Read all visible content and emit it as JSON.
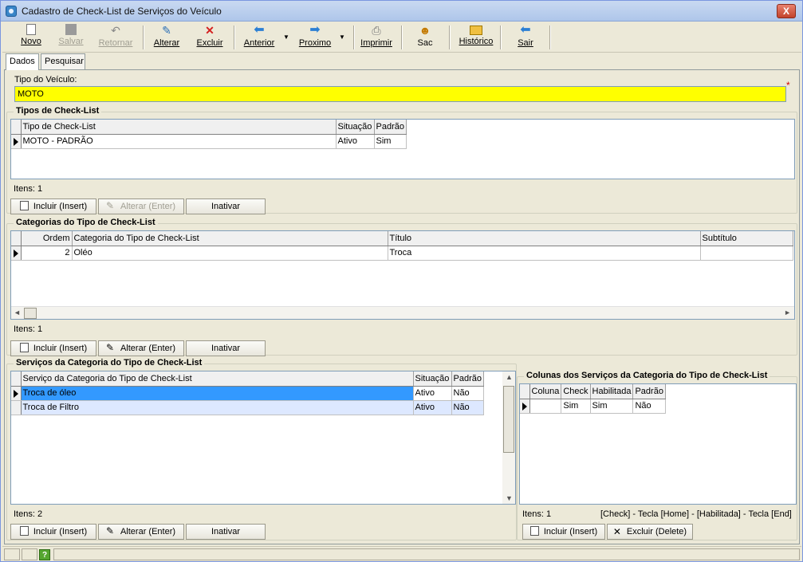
{
  "window": {
    "title": "Cadastro de Check-List de Serviços do Veículo",
    "close": "X"
  },
  "toolbar": {
    "novo": "Novo",
    "salvar": "Salvar",
    "retornar": "Retornar",
    "alterar": "Alterar",
    "excluir": "Excluir",
    "anterior": "Anterior",
    "proximo": "Proximo",
    "imprimir": "Imprimir",
    "sac": "Sac",
    "historico": "Histórico",
    "sair": "Sair"
  },
  "tabs": {
    "dados": "Dados",
    "pesquisar": "Pesquisar"
  },
  "tipo_veiculo": {
    "label": "Tipo do Veículo:",
    "value": "MOTO",
    "required": "*"
  },
  "tipos": {
    "title": "Tipos de Check-List",
    "headers": [
      "Tipo de Check-List",
      "Situação",
      "Padrão"
    ],
    "rows": [
      [
        "MOTO - PADRÃO",
        "Ativo",
        "Sim"
      ]
    ],
    "items_label": "Itens:",
    "items_count": "1",
    "incluir": "Incluir (Insert)",
    "alterar": "Alterar (Enter)",
    "inativar": "Inativar"
  },
  "categorias": {
    "title": "Categorias do Tipo de Check-List",
    "headers": [
      "Ordem",
      "Categoria do Tipo de Check-List",
      "Título",
      "Subtítulo"
    ],
    "rows": [
      [
        "2",
        "Oléo",
        "Troca",
        ""
      ]
    ],
    "items_label": "Itens:",
    "items_count": "1",
    "incluir": "Incluir (Insert)",
    "alterar": "Alterar (Enter)",
    "inativar": "Inativar"
  },
  "servicos": {
    "title": "Serviços da Categoria do Tipo de Check-List",
    "headers": [
      "Serviço da Categoria do Tipo de Check-List",
      "Situação",
      "Padrão"
    ],
    "rows": [
      [
        "Troca de óleo",
        "Ativo",
        "Não"
      ],
      [
        "Troca de Filtro",
        "Ativo",
        "Não"
      ]
    ],
    "items_label": "Itens:",
    "items_count": "2",
    "incluir": "Incluir (Insert)",
    "alterar": "Alterar (Enter)",
    "inativar": "Inativar"
  },
  "colunas": {
    "title": "Colunas dos Serviços da Categoria do Tipo de Check-List",
    "headers": [
      "Coluna",
      "Check",
      "Habilitada",
      "Padrão"
    ],
    "rows": [
      [
        "",
        "Sim",
        "Sim",
        "Não"
      ]
    ],
    "items_label": "Itens:",
    "items_count": "1",
    "hint": "[Check] - Tecla [Home] - [Habilitada] - Tecla [End]",
    "incluir": "Incluir (Insert)",
    "excluir": "Excluir (Delete)"
  },
  "status": {
    "help": "?"
  }
}
